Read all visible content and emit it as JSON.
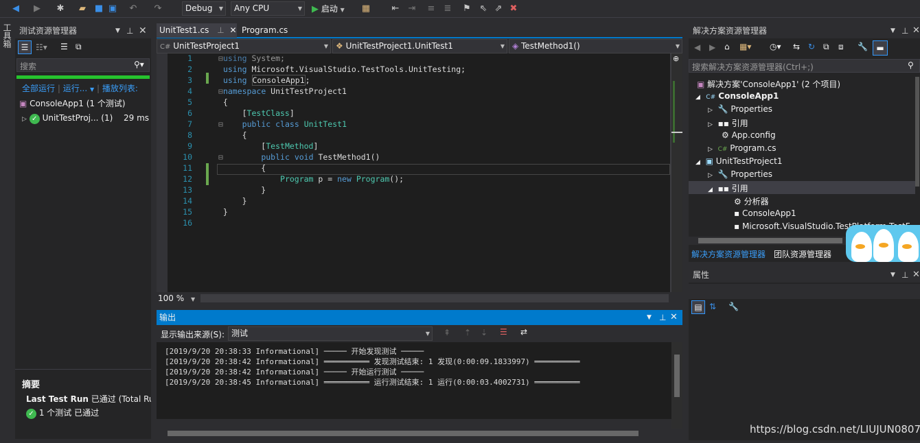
{
  "toolbar": {
    "config": "Debug",
    "platform": "Any CPU",
    "start_label": "启动"
  },
  "left_strip": {
    "label": "工具箱"
  },
  "test_explorer": {
    "title": "测试资源管理器",
    "search_placeholder": "搜索",
    "run_all": "全部运行",
    "run": "运行...",
    "playlist": "播放列表:",
    "project_row": "ConsoleApp1 (1 个测试)",
    "test_row": "UnitTestProj... (1)",
    "test_time": "29 ms",
    "summary_title": "摘要",
    "last_run_prefix": "Last Test Run",
    "last_run_suffix": "已通过 (Total Run",
    "passed": "1 个测试 已通过"
  },
  "doc_tabs": [
    {
      "label": "UnitTest1.cs",
      "active": true
    },
    {
      "label": "Program.cs",
      "active": false
    }
  ],
  "nav": {
    "project": "UnitTestProject1",
    "class": "UnitTestProject1.UnitTest1",
    "member": "TestMethod1()"
  },
  "code_lines": [
    "1",
    "2",
    "3",
    "4",
    "5",
    "6",
    "7",
    "8",
    "9",
    "10",
    "11",
    "12",
    "13",
    "14",
    "15",
    "16"
  ],
  "zoom": "100 %",
  "output": {
    "title": "输出",
    "source_label": "显示输出来源(S):",
    "source_value": "测试",
    "lines": [
      "[2019/9/20 20:38:33 Informational] ───── 开始发现测试 ─────",
      "[2019/9/20 20:38:42 Informational] ══════════ 发现测试结束: 1 发现(0:00:09.1833997) ══════════",
      "[2019/9/20 20:38:42 Informational] ───── 开始运行测试 ─────",
      "[2019/9/20 20:38:45 Informational] ══════════ 运行测试结束: 1 运行(0:00:03.4002731) ══════════"
    ]
  },
  "solution_explorer": {
    "title": "解决方案资源管理器",
    "search_placeholder": "搜索解决方案资源管理器(Ctrl+;)",
    "solution": "解决方案'ConsoleApp1' (2 个项目)",
    "items": [
      {
        "label": "ConsoleApp1",
        "bold": true
      },
      {
        "label": "Properties"
      },
      {
        "label": "引用"
      },
      {
        "label": "App.config"
      },
      {
        "label": "Program.cs"
      },
      {
        "label": "UnitTestProject1"
      },
      {
        "label": "Properties"
      },
      {
        "label": "引用"
      },
      {
        "label": "分析器"
      },
      {
        "label": "ConsoleApp1"
      },
      {
        "label": "Microsoft.VisualStudio.TestPlatform.TestF"
      }
    ],
    "tab_solution": "解决方案资源管理器",
    "tab_team": "团队资源管理器"
  },
  "properties": {
    "title": "属性"
  },
  "watermark": "https://blog.csdn.net/LIUJUN0807",
  "colors": {
    "accent": "#007acc",
    "pass": "#3fb950",
    "green_bar": "#26c32e"
  }
}
